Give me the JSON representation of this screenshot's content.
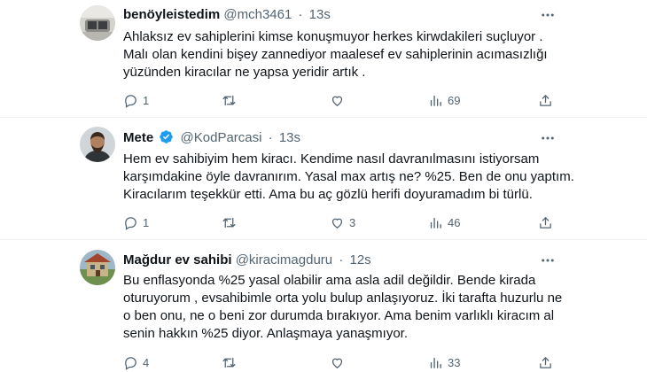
{
  "tweets": [
    {
      "name": "benöyleistedim",
      "handle": "@mch3461",
      "time": "13s",
      "verified": false,
      "lines": [
        "Ahlaksız ev sahiplerini kimse konuşmuyor herkes kirwdakileri suçluyor .",
        "Malı olan kendini bişey zannediyor maalesef ev sahiplerinin acımasızlığı",
        "yüzünden kiracılar ne yapsa yeridir artık ."
      ],
      "replies": "1",
      "retweets": "",
      "likes": "",
      "views": "69"
    },
    {
      "name": "Mete",
      "handle": "@KodParcasi",
      "time": "13s",
      "verified": true,
      "lines": [
        "Hem ev sahibiyim hem kiracı. Kendime nasıl davranılmasını istiyorsam",
        "karşımdakine öyle davranırım. Yasal max artış ne? %25. Ben de onu yaptım.",
        "Kiracılarım teşekkür etti. Ama bu aç gözlü herifi doyuramadım bi türlü."
      ],
      "replies": "1",
      "retweets": "",
      "likes": "3",
      "views": "46"
    },
    {
      "name": "Mağdur ev sahibi",
      "handle": "@kiracimagduru",
      "time": "12s",
      "verified": false,
      "lines": [
        "Bu enflasyonda %25 yasal olabilir ama asla adil değildir. Bende kirada",
        "oturuyorum , evsahibimle orta yolu bulup anlaşıyoruz. İki tarafta huzurlu ne",
        "o ben onu, ne o beni zor durumda bırakıyor. Ama benim varlıklı kiracım al",
        "senin hakkın %25 diyor. Anlaşmaya yanaşmıyor."
      ],
      "replies": "4",
      "retweets": "",
      "likes": "",
      "views": "33"
    }
  ],
  "colors": {
    "text": "#0f1419",
    "secondary": "#536471",
    "verified": "#1d9bf0",
    "divider": "#eff3f4"
  },
  "icons": [
    "more-icon",
    "reply-icon",
    "retweet-icon",
    "like-icon",
    "views-icon",
    "share-icon",
    "verified-icon"
  ]
}
